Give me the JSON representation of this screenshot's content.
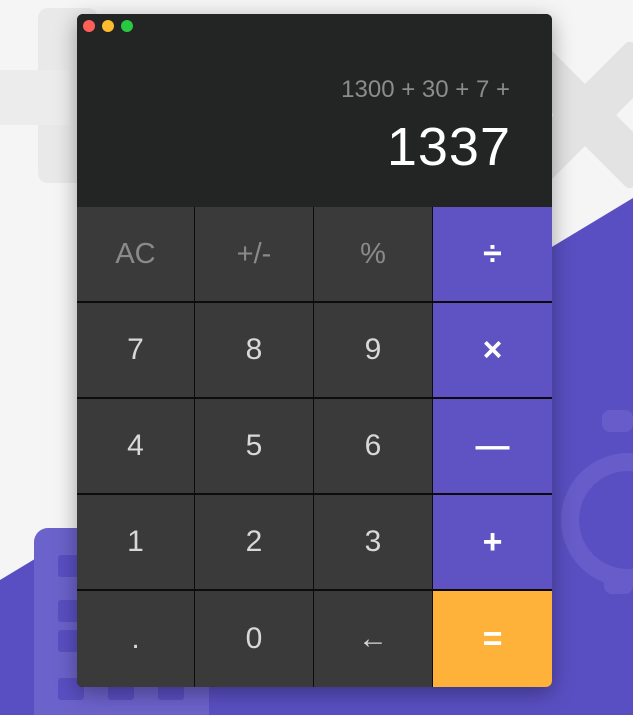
{
  "window": {
    "controls": [
      "close",
      "minimize",
      "maximize"
    ]
  },
  "display": {
    "expression": "1300 + 30 + 7 +",
    "result": "1337"
  },
  "keys": {
    "ac": "AC",
    "sign": "+/-",
    "percent": "%",
    "divide": "÷",
    "seven": "7",
    "eight": "8",
    "nine": "9",
    "multiply": "×",
    "four": "4",
    "five": "5",
    "six": "6",
    "subtract": "—",
    "one": "1",
    "two": "2",
    "three": "3",
    "add": "+",
    "decimal": ".",
    "zero": "0",
    "backspace": "←",
    "equals": "="
  },
  "colors": {
    "operator": "#5f53c4",
    "equals": "#ffb23a",
    "key": "#3a3a3a",
    "display": "#232424",
    "background_accent": "#5a4fc2"
  }
}
